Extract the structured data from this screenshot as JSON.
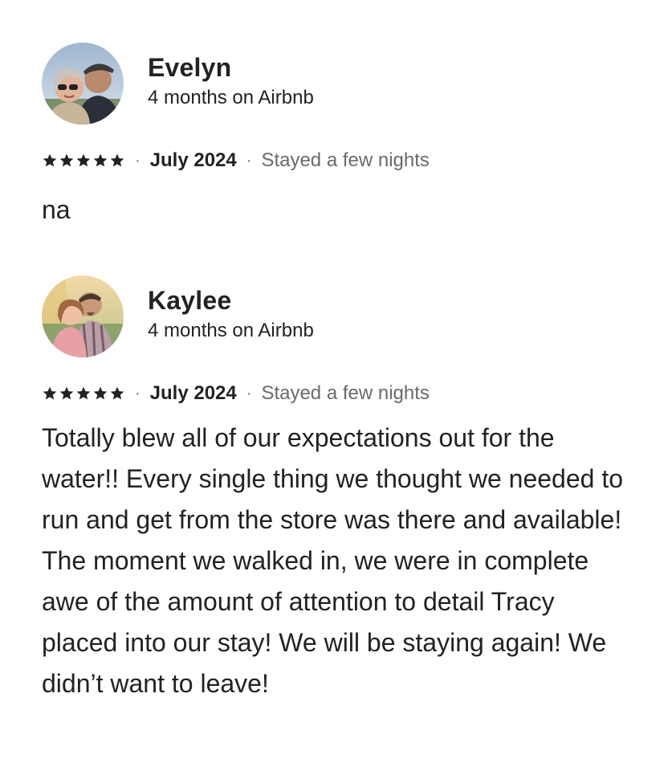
{
  "reviews": [
    {
      "name": "Evelyn",
      "tenure": "4 months on Airbnb",
      "rating": 5,
      "date": "July 2024",
      "separator": "·",
      "stay": "Stayed a few nights",
      "text": "na",
      "avatar_icon": "photo-avatar-couple"
    },
    {
      "name": "Kaylee",
      "tenure": "4 months on Airbnb",
      "rating": 5,
      "date": "July 2024",
      "separator": "·",
      "stay": "Stayed a few nights",
      "text": "Totally blew all of our expectations out for the water!! Every single thing we thought we needed to run and get from the store was there and available! The moment we walked in, we were in complete awe of the amount of attention to detail Tracy placed into our stay! We will be staying again! We didn’t want to leave!",
      "avatar_icon": "photo-avatar-couple"
    }
  ],
  "colors": {
    "text": "#222222",
    "muted": "#6a6a6a",
    "star": "#222222"
  }
}
